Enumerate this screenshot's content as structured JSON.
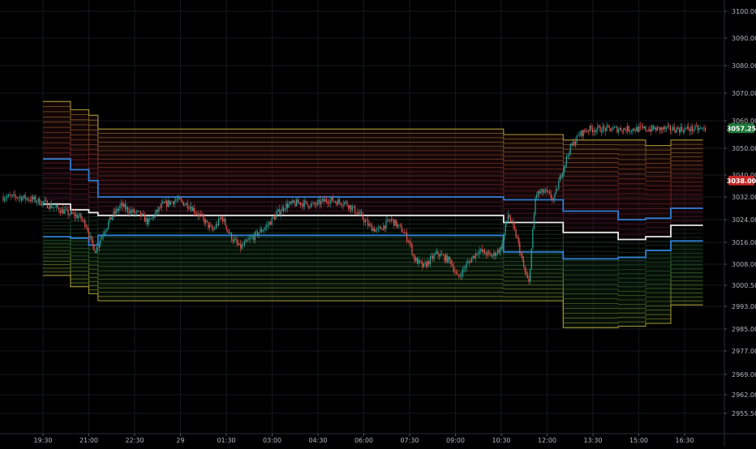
{
  "chart_data": {
    "type": "candlestick",
    "title": "",
    "y_axis": {
      "side": "right",
      "ticks": [
        "3100.00",
        "3090.00",
        "3080.00",
        "3070.00",
        "3060.00",
        "3050.00",
        "3040.00",
        "3032.00",
        "3024.00",
        "3016.00",
        "3008.00",
        "3000.50",
        "2993.00",
        "2985.00",
        "2977.00",
        "2969.00",
        "2962.00",
        "2955.50"
      ],
      "ylim": [
        2950,
        3104
      ]
    },
    "x_axis": {
      "ticks": [
        "19:30",
        "21:00",
        "22:30",
        "29",
        "01:30",
        "03:00",
        "04:30",
        "06:00",
        "07:30",
        "09:00",
        "10:30",
        "12:00",
        "13:30",
        "15:00",
        "16:30"
      ]
    },
    "price_tags": [
      {
        "label": "3057.25",
        "value": 3057.25,
        "color": "#1f7a3a"
      },
      {
        "label": "3038.00",
        "value": 3038.0,
        "color": "#c62828"
      }
    ],
    "bands": {
      "segments": [
        {
          "x0": 0.0,
          "x1": 0.6,
          "top": 3067,
          "upper_band": 3046,
          "vwap": 3029.5,
          "lower_band": 3018,
          "bottom": 3004
        },
        {
          "x0": 0.6,
          "x1": 1.0,
          "top": 3064,
          "upper_band": 3042,
          "vwap": 3027.5,
          "lower_band": 3017.5,
          "bottom": 3000
        },
        {
          "x0": 1.0,
          "x1": 1.2,
          "top": 3062,
          "upper_band": 3038,
          "vwap": 3026.5,
          "lower_band": 3015,
          "bottom": 2997.5
        },
        {
          "x0": 1.2,
          "x1": 10.05,
          "top": 3057,
          "upper_band": 3032,
          "vwap": 3025.5,
          "lower_band": 3018.5,
          "bottom": 2995
        },
        {
          "x0": 10.05,
          "x1": 11.35,
          "top": 3055,
          "upper_band": 3031,
          "vwap": 3023,
          "lower_band": 3012.5,
          "bottom": 2995
        },
        {
          "x0": 11.35,
          "x1": 12.55,
          "top": 3053,
          "upper_band": 3027,
          "vwap": 3019.5,
          "lower_band": 3010,
          "bottom": 2985.5
        },
        {
          "x0": 12.55,
          "x1": 13.15,
          "top": 3053,
          "upper_band": 3024,
          "vwap": 3017,
          "lower_band": 3010.5,
          "bottom": 2986
        },
        {
          "x0": 13.15,
          "x1": 13.7,
          "top": 3051,
          "upper_band": 3024.5,
          "vwap": 3018,
          "lower_band": 3013,
          "bottom": 2987
        },
        {
          "x0": 13.7,
          "x1": 14.4,
          "top": 3053,
          "upper_band": 3028,
          "vwap": 3022,
          "lower_band": 3016.5,
          "bottom": 2993.5
        }
      ]
    },
    "price_path": [
      {
        "x": -0.5,
        "y": 3032
      },
      {
        "x": -0.2,
        "y": 3031
      },
      {
        "x": 0.0,
        "y": 3030
      },
      {
        "x": 0.3,
        "y": 3028
      },
      {
        "x": 0.6,
        "y": 3026
      },
      {
        "x": 0.8,
        "y": 3025
      },
      {
        "x": 0.95,
        "y": 3022
      },
      {
        "x": 1.05,
        "y": 3016
      },
      {
        "x": 1.15,
        "y": 3013
      },
      {
        "x": 1.3,
        "y": 3019
      },
      {
        "x": 1.5,
        "y": 3025
      },
      {
        "x": 1.7,
        "y": 3029
      },
      {
        "x": 1.9,
        "y": 3027
      },
      {
        "x": 2.1,
        "y": 3026
      },
      {
        "x": 2.3,
        "y": 3023
      },
      {
        "x": 2.6,
        "y": 3029
      },
      {
        "x": 2.9,
        "y": 3031
      },
      {
        "x": 3.2,
        "y": 3029
      },
      {
        "x": 3.5,
        "y": 3024
      },
      {
        "x": 3.7,
        "y": 3020
      },
      {
        "x": 3.9,
        "y": 3025
      },
      {
        "x": 4.1,
        "y": 3018
      },
      {
        "x": 4.3,
        "y": 3014
      },
      {
        "x": 4.6,
        "y": 3018
      },
      {
        "x": 4.9,
        "y": 3022
      },
      {
        "x": 5.1,
        "y": 3026
      },
      {
        "x": 5.3,
        "y": 3029
      },
      {
        "x": 5.6,
        "y": 3030
      },
      {
        "x": 5.9,
        "y": 3029
      },
      {
        "x": 6.2,
        "y": 3031
      },
      {
        "x": 6.6,
        "y": 3030
      },
      {
        "x": 6.9,
        "y": 3026
      },
      {
        "x": 7.1,
        "y": 3022
      },
      {
        "x": 7.3,
        "y": 3020
      },
      {
        "x": 7.6,
        "y": 3024
      },
      {
        "x": 7.85,
        "y": 3020
      },
      {
        "x": 8.0,
        "y": 3016
      },
      {
        "x": 8.1,
        "y": 3010
      },
      {
        "x": 8.3,
        "y": 3007
      },
      {
        "x": 8.6,
        "y": 3012
      },
      {
        "x": 8.9,
        "y": 3009
      },
      {
        "x": 9.05,
        "y": 3003
      },
      {
        "x": 9.25,
        "y": 3008
      },
      {
        "x": 9.5,
        "y": 3013
      },
      {
        "x": 9.8,
        "y": 3011
      },
      {
        "x": 10.0,
        "y": 3014
      },
      {
        "x": 10.15,
        "y": 3026
      },
      {
        "x": 10.35,
        "y": 3017
      },
      {
        "x": 10.5,
        "y": 3006
      },
      {
        "x": 10.6,
        "y": 3001
      },
      {
        "x": 10.75,
        "y": 3033
      },
      {
        "x": 10.95,
        "y": 3034
      },
      {
        "x": 11.15,
        "y": 3031
      },
      {
        "x": 11.3,
        "y": 3040
      },
      {
        "x": 11.5,
        "y": 3050
      },
      {
        "x": 11.7,
        "y": 3055
      },
      {
        "x": 11.9,
        "y": 3057
      }
    ]
  }
}
